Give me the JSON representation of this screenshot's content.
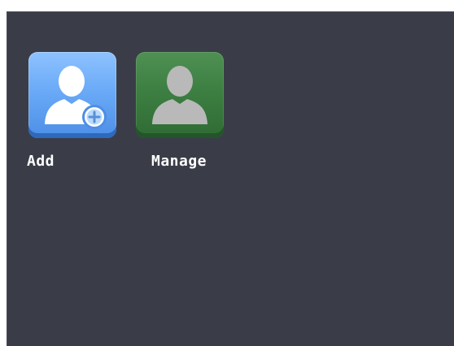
{
  "apps": [
    {
      "label": "Add",
      "icon": "user-add-icon",
      "color": "#6aaaf7"
    },
    {
      "label": "Manage",
      "icon": "user-icon",
      "color": "#3d7f42"
    }
  ],
  "colors": {
    "background": "#3a3d48",
    "label_text": "#ffffff"
  }
}
